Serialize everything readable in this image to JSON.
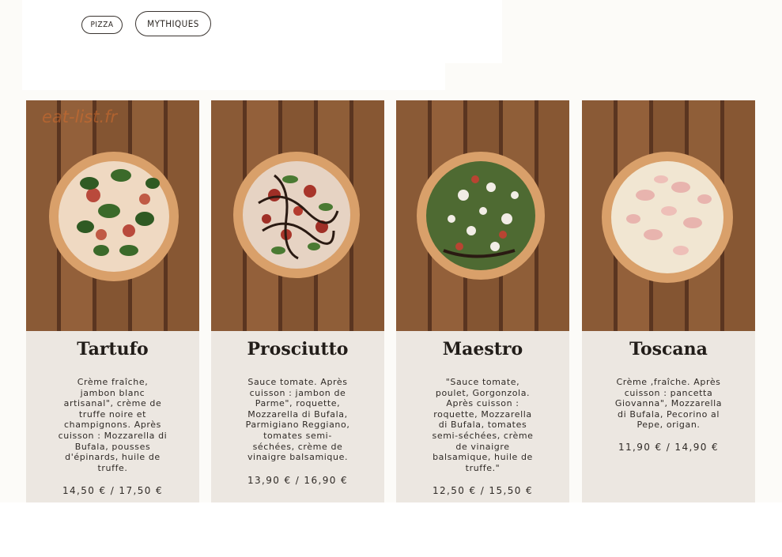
{
  "tags": [
    {
      "label": "PIZZA"
    },
    {
      "label": "MYTHIQUES"
    }
  ],
  "watermark": "eat-list.fr",
  "cards": [
    {
      "name": "Tartufo",
      "description": "Crème fraîche, \njambon blanc \nartisanal\", crème de \ntruffe noire et \nchampignons. Après \ncuisson : Mozzarella di \nBufala, pousses \nd'épinards, huile de \ntruffe.",
      "price": "14,50 € / 17,50 €"
    },
    {
      "name": "Prosciutto",
      "description": "Sauce tomate. Après \ncuisson : jambon de \nParme\", roquette, \nMozzarella di Bufala, \nParmigiano Reggiano, \ntomates semi-\nséchées, crème de \nvinaigre balsamique.",
      "price": "13,90 € / 16,90 €"
    },
    {
      "name": "Maestro",
      "description": "\"Sauce tomate, \npoulet, Gorgonzola. \nAprès cuisson : \nroquette, Mozzarella \ndi Bufala, tomates \nsemi-séchées, crème \nde vinaigre \nbalsamique, huile de \ntruffe.\"",
      "price": "12,50 € / 15,50 €"
    },
    {
      "name": "Toscana",
      "description": "Crème ,fraîche. Après \ncuisson : pancetta \nGiovanna\", Mozzarella \ndi Bufala, Pecorino al \nPepe, origan.",
      "price": "11,90 € / 14,90 €"
    }
  ]
}
